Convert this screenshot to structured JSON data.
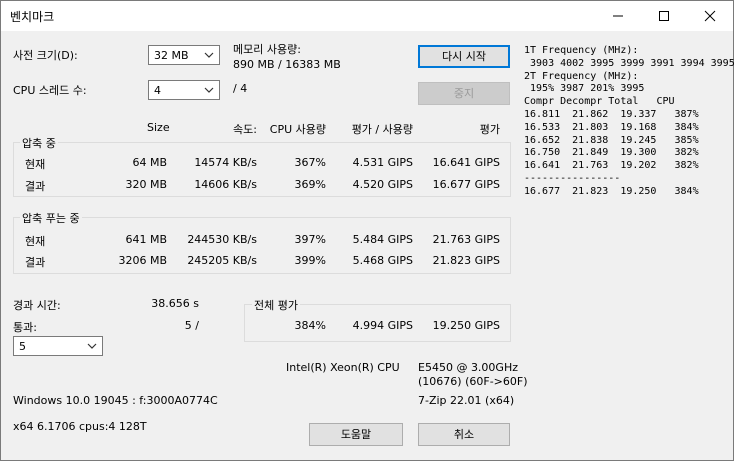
{
  "window": {
    "title": "벤치마크",
    "controls": {
      "minimize": "minimize-icon",
      "maximize": "maximize-icon",
      "close": "close-icon"
    }
  },
  "settings": {
    "dict_label": "사전 크기(D):",
    "dict_value": "32 MB",
    "threads_label": "CPU 스레드 수:",
    "threads_value": "4",
    "memory_label": "메모리 사용량:",
    "memory_value": "890 MB / 16383 MB",
    "threads_total": "/ 4"
  },
  "buttons": {
    "restart": "다시 시작",
    "stop": "중지",
    "help": "도움말",
    "cancel": "취소"
  },
  "headers": {
    "size": "Size",
    "speed": "속도:",
    "cpu": "CPU 사용량",
    "avg": "평가 / 사용량",
    "rating": "평가"
  },
  "compress": {
    "label": "압축 중",
    "rows": [
      {
        "name": "현재",
        "size": "64 MB",
        "speed": "14574 KB/s",
        "cpu": "367%",
        "avg": "4.531 GIPS",
        "rating": "16.641 GIPS"
      },
      {
        "name": "결과",
        "size": "320 MB",
        "speed": "14606 KB/s",
        "cpu": "369%",
        "avg": "4.520 GIPS",
        "rating": "16.677 GIPS"
      }
    ]
  },
  "decompress": {
    "label": "압축 푸는 중",
    "rows": [
      {
        "name": "현재",
        "size": "641 MB",
        "speed": "244530 KB/s",
        "cpu": "397%",
        "avg": "5.484 GIPS",
        "rating": "21.763 GIPS"
      },
      {
        "name": "결과",
        "size": "3206 MB",
        "speed": "245205 KB/s",
        "cpu": "399%",
        "avg": "5.468 GIPS",
        "rating": "21.823 GIPS"
      }
    ]
  },
  "elapsed": {
    "label": "경과 시간:",
    "value": "38.656 s"
  },
  "passes": {
    "label": "통과:",
    "value": "5 /",
    "select_value": "5"
  },
  "overall": {
    "label": "전체 평가",
    "cpu": "384%",
    "avg": "4.994 GIPS",
    "rating": "19.250 GIPS"
  },
  "cpu_info": {
    "name": "Intel(R) Xeon(R) CPU",
    "model": "E5450  @ 3.00GHz",
    "id": "(10676) (60F->60F)"
  },
  "sys_info": {
    "os": "Windows 10.0 19045 : f:3000A0774C",
    "zip": "7-Zip 22.01 (x64)",
    "arch": "x64 6.1706 cpus:4 128T"
  },
  "log": [
    "1T Frequency (MHz):",
    " 3903 4002 3995 3999 3991 3994 3995",
    "2T Frequency (MHz):",
    " 195% 3987 201% 3995",
    "Compr Decompr Total   CPU",
    "16.811  21.862  19.337   387%",
    "16.533  21.803  19.168   384%",
    "16.652  21.838  19.245   385%",
    "16.750  21.849  19.300   382%",
    "16.641  21.763  19.202   382%",
    "----------------",
    "16.677  21.823  19.250   384%"
  ]
}
